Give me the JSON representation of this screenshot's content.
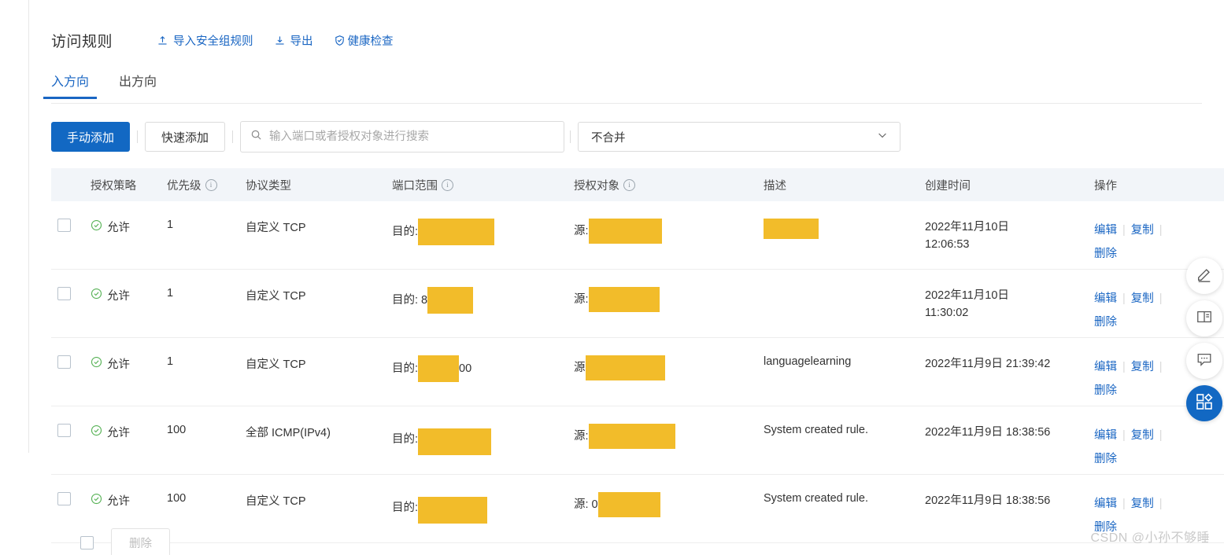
{
  "header": {
    "title": "访问规则",
    "actions": [
      {
        "label": "导入安全组规则",
        "icon": "upload-icon"
      },
      {
        "label": "导出",
        "icon": "download-icon"
      },
      {
        "label": "健康检查",
        "icon": "shield-check-icon"
      }
    ]
  },
  "tabs": [
    {
      "label": "入方向",
      "active": true
    },
    {
      "label": "出方向",
      "active": false
    }
  ],
  "toolbar": {
    "manual_add_label": "手动添加",
    "quick_add_label": "快速添加",
    "search_placeholder": "输入端口或者授权对象进行搜索",
    "search_value": "",
    "merge_select_value": "不合并"
  },
  "table": {
    "columns": {
      "policy": "授权策略",
      "priority": "优先级",
      "protocol": "协议类型",
      "port_range": "端口范围",
      "target": "授权对象",
      "description": "描述",
      "created": "创建时间",
      "operations": "操作"
    },
    "rows": [
      {
        "policy": "允许",
        "priority": "1",
        "protocol": "自定义 TCP",
        "port_prefix": "目的:",
        "port_suffix": "",
        "port_redact_width": 97,
        "target_prefix": "源:",
        "target_redact_width": 93,
        "description": "",
        "desc_redact_width": 70,
        "created_date": "2022年11月10日",
        "created_time": "12:06:53"
      },
      {
        "policy": "允许",
        "priority": "1",
        "protocol": "自定义 TCP",
        "port_prefix": "目的: 8",
        "port_suffix": "",
        "port_redact_width": 58,
        "target_prefix": "源:",
        "target_redact_width": 90,
        "description": "",
        "desc_redact_width": 0,
        "created_date": "2022年11月10日",
        "created_time": "11:30:02"
      },
      {
        "policy": "允许",
        "priority": "1",
        "protocol": "自定义 TCP",
        "port_prefix": "目的:",
        "port_suffix": "00",
        "port_redact_width": 52,
        "target_prefix": "源",
        "target_redact_width": 101,
        "description": "languagelearning",
        "desc_redact_width": 0,
        "created_date": "2022年11月9日 21:39:42",
        "created_time": ""
      },
      {
        "policy": "允许",
        "priority": "100",
        "protocol": "全部 ICMP(IPv4)",
        "port_prefix": "目的:",
        "port_suffix": "",
        "port_redact_width": 93,
        "target_prefix": "源:",
        "target_redact_width": 110,
        "description": "System created rule.",
        "desc_redact_width": 0,
        "created_date": "2022年11月9日 18:38:56",
        "created_time": ""
      },
      {
        "policy": "允许",
        "priority": "100",
        "protocol": "自定义 TCP",
        "port_prefix": "目的:",
        "port_suffix": "",
        "port_redact_width": 88,
        "target_prefix": "源: 0",
        "target_redact_width": 79,
        "description": "System created rule.",
        "desc_redact_width": 0,
        "created_date": "2022年11月9日 18:38:56",
        "created_time": ""
      }
    ],
    "operations": {
      "edit": "编辑",
      "copy": "复制",
      "delete": "删除",
      "divider": "|"
    }
  },
  "footer": {
    "delete_label": "删除"
  },
  "rail": [
    {
      "icon": "pencil-icon",
      "accent": false
    },
    {
      "icon": "book-icon",
      "accent": false
    },
    {
      "icon": "chat-icon",
      "accent": false
    },
    {
      "icon": "apps-grid-icon",
      "accent": true
    }
  ],
  "watermark": "CSDN @小孙不够睡",
  "colors": {
    "accent": "#1268c3",
    "link": "#1a66c3",
    "allow": "#4caf50",
    "redaction": "#f2bc2a",
    "header_bg": "#f2f5f9"
  }
}
